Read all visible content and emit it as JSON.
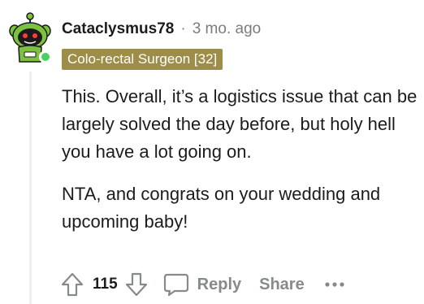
{
  "comment": {
    "author": "Cataclysmus78",
    "separator": "·",
    "time": "3 mo. ago",
    "flair": "Colo-rectal Surgeon [32]",
    "paragraphs": [
      "This. Overall, it’s a logistics issue that can be largely solved the day before, but holy hell you have a lot going on.",
      "NTA, and congrats on your wedding and upcoming baby!"
    ]
  },
  "actions": {
    "score": "115",
    "reply": "Reply",
    "share": "Share"
  },
  "icons": {
    "upvote": "arrow-up-icon",
    "downvote": "arrow-down-icon",
    "reply": "speech-bubble-icon",
    "more": "ellipsis-icon"
  },
  "colors": {
    "flair_bg": "#9e8d49",
    "online": "#46d160",
    "muted": "#878a8c"
  }
}
